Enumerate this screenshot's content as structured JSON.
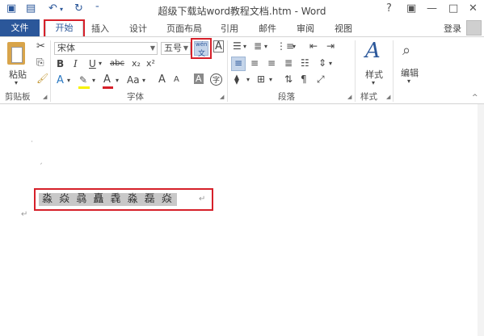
{
  "window": {
    "title": "超级下载站word教程文档.htm - Word",
    "help": "?",
    "restore": "▣",
    "minimize": "—",
    "maximize": "□",
    "close": "✕"
  },
  "tabs": {
    "file": "文件",
    "home": "开始",
    "insert": "插入",
    "design": "设计",
    "layout": "页面布局",
    "references": "引用",
    "mailings": "邮件",
    "review": "审阅",
    "view": "视图",
    "login": "登录"
  },
  "ribbon": {
    "clipboard": {
      "paste": "粘贴",
      "group": "剪贴板"
    },
    "font": {
      "family": "宋体",
      "size": "五号",
      "phonetic": "wén",
      "phonetic_char": "文",
      "bold": "B",
      "italic": "I",
      "underline": "U",
      "strike": "abc",
      "subscript": "x₂",
      "superscript": "x²",
      "text_effect": "A",
      "font_color": "A",
      "change_case": "Aa",
      "grow": "A",
      "shrink": "A",
      "char_shading": "A",
      "enclose": "字",
      "border_char": "A",
      "group": "字体"
    },
    "paragraph": {
      "group": "段落"
    },
    "styles": {
      "button": "样式",
      "group": "样式"
    },
    "editing": {
      "button": "编辑"
    }
  },
  "document": {
    "selected_text": "淼 焱 骉 矗 毳 淼 磊 焱"
  },
  "colors": {
    "accent": "#2b579a",
    "highlight_red": "#d6202a",
    "selection": "#c8c8c8"
  }
}
